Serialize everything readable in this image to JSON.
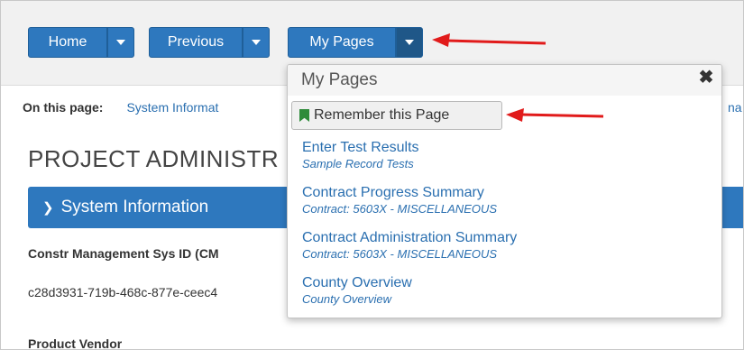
{
  "toolbar": {
    "home_label": "Home",
    "previous_label": "Previous",
    "my_pages_label": "My Pages"
  },
  "on_this_page": {
    "label": "On this page:",
    "link1": "System Informat",
    "link_right": "na"
  },
  "page_title": "PROJECT ADMINISTR",
  "section": {
    "title": "System Information"
  },
  "fields": {
    "label1": "Constr Management Sys ID (CM",
    "value1": "c28d3931-719b-468c-877e-ceec4",
    "label2_partial": "Product Vendor"
  },
  "dropdown": {
    "title": "My Pages",
    "remember_label": "Remember this Page",
    "items": [
      {
        "title": "Enter Test Results",
        "subtitle": "Sample Record Tests"
      },
      {
        "title": "Contract Progress Summary",
        "subtitle": "Contract: 5603X - MISCELLANEOUS"
      },
      {
        "title": "Contract Administration Summary",
        "subtitle": "Contract: 5603X - MISCELLANEOUS"
      },
      {
        "title": "County Overview",
        "subtitle": "County Overview"
      }
    ]
  },
  "colors": {
    "primary": "#2e78be",
    "link": "#2a6fb0",
    "arrow": "#e11b1b",
    "bookmark": "#2e8b3a"
  }
}
